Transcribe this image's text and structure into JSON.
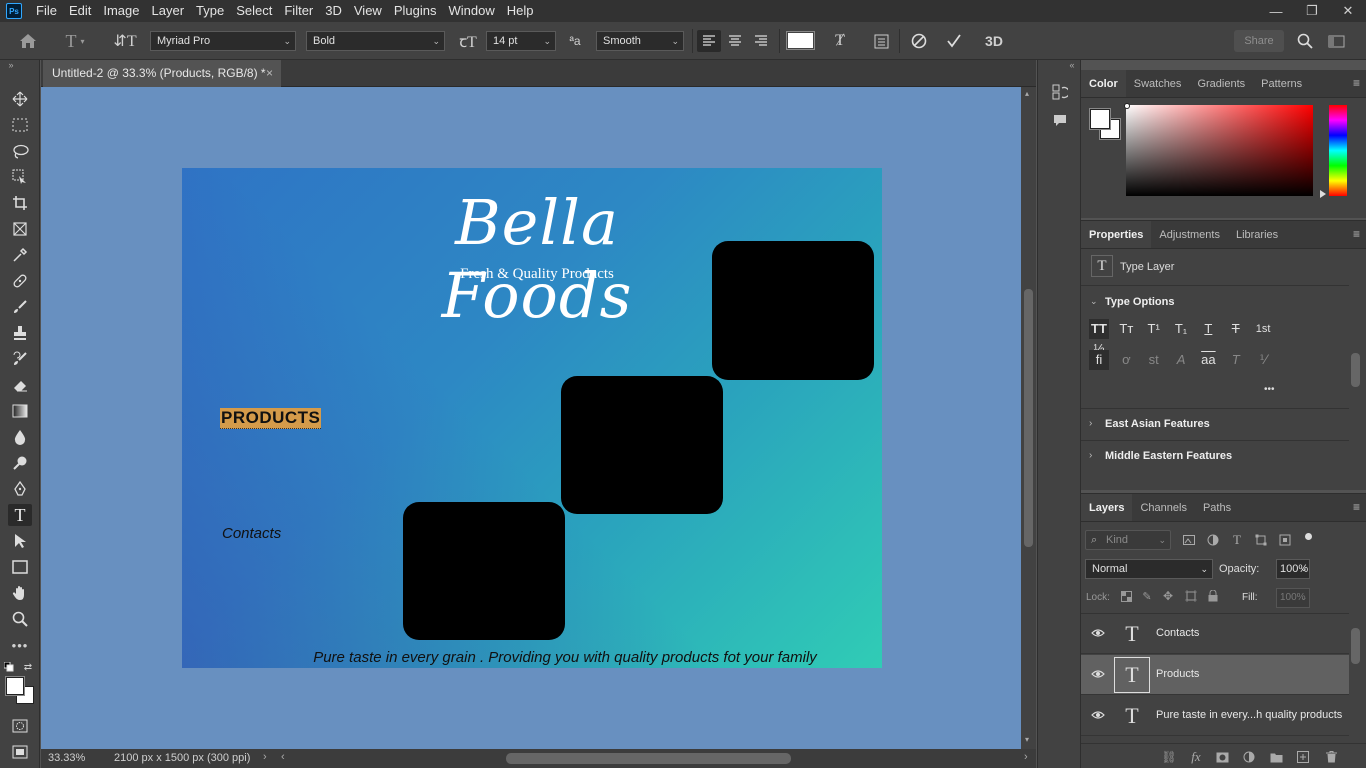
{
  "menubar": {
    "logo": "Ps",
    "items": [
      "File",
      "Edit",
      "Image",
      "Layer",
      "Type",
      "Select",
      "Filter",
      "3D",
      "View",
      "Plugins",
      "Window",
      "Help"
    ],
    "window_controls": {
      "minimize": "—",
      "restore": "❐",
      "close": "✕"
    }
  },
  "options": {
    "font_family": "Myriad Pro",
    "font_style": "Bold",
    "font_size": "14 pt",
    "aa_glyph": "ªa",
    "antialias": "Smooth",
    "share_label": "Share",
    "threed_label": "3D",
    "text_color": "#ffffff"
  },
  "document": {
    "tab_title": "Untitled-2 @ 33.3% (Products, RGB/8) *",
    "close_glyph": "×",
    "zoom": "33.33%",
    "doc_info": "2100 px x 1500 px (300 ppi)"
  },
  "artboard": {
    "brand_title": "Bella Foods",
    "tagline": "Fresh & Quality Products",
    "products_label": "PRODUCTS",
    "contacts_label": "Contacts",
    "slogan": "Pure taste in every grain . Providing you with quality products fot your family"
  },
  "color_panel": {
    "tabs": [
      "Color",
      "Swatches",
      "Gradients",
      "Patterns"
    ],
    "active_tab": "Color",
    "foreground": "#ffffff",
    "background": "#ffffff",
    "hue_base": "#ff0000"
  },
  "properties_panel": {
    "tabs": [
      "Properties",
      "Adjustments",
      "Libraries"
    ],
    "active_tab": "Properties",
    "layer_kind": "Type Layer",
    "type_options_header": "Type Options",
    "type_option_glyphs_row1": [
      "TT",
      "Tт",
      "T¹",
      "T₁",
      "T",
      "T",
      "1st",
      "½"
    ],
    "type_option_glyphs_row2": [
      "fi",
      "ơ",
      "st",
      "A",
      "aa",
      "T",
      "⅟"
    ],
    "more": "•••",
    "sections": [
      "East Asian Features",
      "Middle Eastern Features"
    ]
  },
  "layers_panel": {
    "tabs": [
      "Layers",
      "Channels",
      "Paths"
    ],
    "active_tab": "Layers",
    "filter_placeholder": "Kind",
    "blend_mode": "Normal",
    "opacity_label": "Opacity:",
    "opacity_value": "100%",
    "lock_label": "Lock:",
    "fill_label": "Fill:",
    "fill_value": "100%",
    "layers": [
      {
        "name": "Contacts",
        "selected": false
      },
      {
        "name": "Products",
        "selected": true
      },
      {
        "name": "Pure taste in every...h quality products",
        "selected": false
      }
    ]
  }
}
